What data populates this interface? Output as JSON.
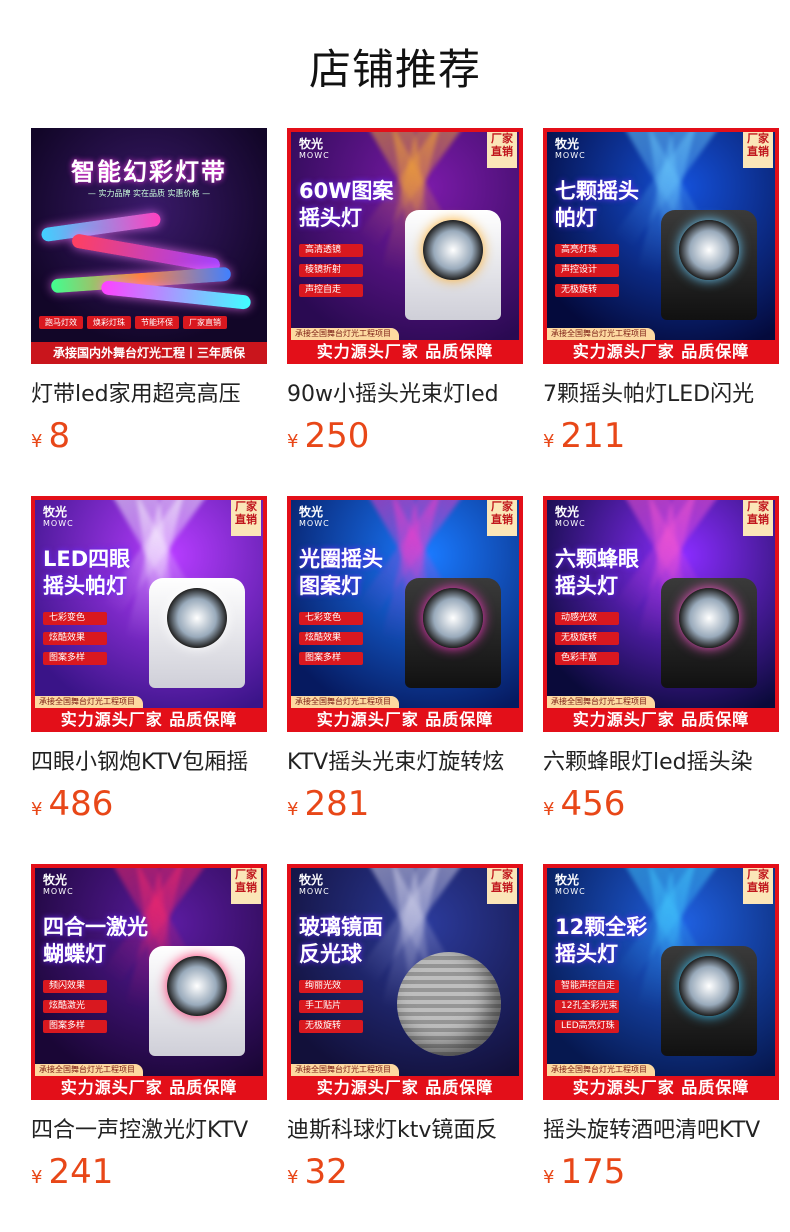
{
  "header": {
    "title": "店铺推荐"
  },
  "currency": "¥",
  "promo": {
    "brand": "牧光",
    "brand_en": "MOWC",
    "corner": "厂家直销",
    "band": "实力源头厂家 品质保障",
    "band_small": "承接全国舞台灯光工程项目"
  },
  "first_card": {
    "headline": "智能幻彩灯带",
    "sub": "— 实力品牌 实在品质 实惠价格 —",
    "tags": [
      "跑马灯效",
      "焕彩灯珠",
      "节能环保",
      "厂家直销"
    ],
    "band": "承接国内外舞台灯光工程丨三年质保"
  },
  "products": [
    {
      "name": "灯带led家用超亮高压",
      "price": "8",
      "image_title": "",
      "features": []
    },
    {
      "name": "90w小摇头光束灯led",
      "price": "250",
      "image_title": "60W图案\n摇头灯",
      "features": [
        "高清透镜",
        "棱镜折射",
        "声控自走"
      ]
    },
    {
      "name": "7颗摇头帕灯LED闪光",
      "price": "211",
      "image_title": "七颗摇头\n帕灯",
      "features": [
        "高亮灯珠",
        "声控设计",
        "无极旋转"
      ]
    },
    {
      "name": "四眼小钢炮KTV包厢摇",
      "price": "486",
      "image_title": "LED四眼\n摇头帕灯",
      "features": [
        "七彩变色",
        "炫酷效果",
        "图案多样"
      ]
    },
    {
      "name": "KTV摇头光束灯旋转炫",
      "price": "281",
      "image_title": "光圈摇头\n图案灯",
      "features": [
        "七彩变色",
        "炫酷效果",
        "图案多样"
      ]
    },
    {
      "name": "六颗蜂眼灯led摇头染",
      "price": "456",
      "image_title": "六颗蜂眼\n摇头灯",
      "features": [
        "动感光效",
        "无极旋转",
        "色彩丰富"
      ]
    },
    {
      "name": "四合一声控激光灯KTV",
      "price": "241",
      "image_title": "四合一激光\n蝴蝶灯",
      "features": [
        "频闪效果",
        "炫酷激光",
        "图案多样"
      ]
    },
    {
      "name": "迪斯科球灯ktv镜面反",
      "price": "32",
      "image_title": "玻璃镜面\n反光球",
      "features": [
        "绚丽光效",
        "手工贴片",
        "无极旋转"
      ]
    },
    {
      "name": "摇头旋转酒吧清吧KTV",
      "price": "175",
      "image_title": "12颗全彩\n摇头灯",
      "features": [
        "智能声控自走",
        "12孔全彩光束",
        "LED高亮灯珠"
      ]
    }
  ],
  "colors": {
    "price": "#e84718",
    "band": "#e30f19",
    "title": "#111111"
  }
}
